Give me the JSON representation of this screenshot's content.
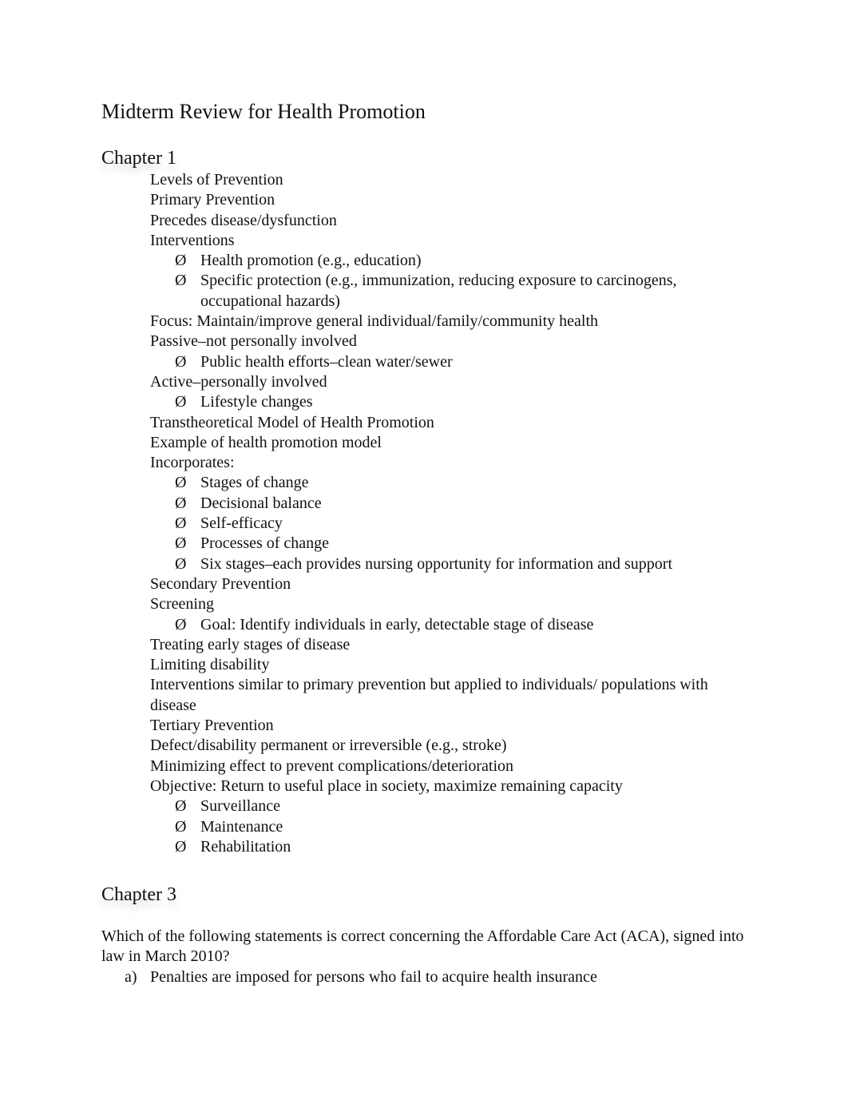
{
  "document": {
    "title": "Midterm Review for Health Promotion",
    "chapter1": {
      "heading": "Chapter 1",
      "lines": [
        {
          "type": "text",
          "text": "Levels of Prevention"
        },
        {
          "type": "text",
          "text": "Primary Prevention"
        },
        {
          "type": "text",
          "text": "Precedes disease/dysfunction"
        },
        {
          "type": "text",
          "text": "Interventions"
        },
        {
          "type": "bullet",
          "text": "Health promotion (e.g., education)"
        },
        {
          "type": "bullet",
          "text": "Specific protection (e.g., immunization, reducing exposure to carcinogens, occupational hazards)"
        },
        {
          "type": "text",
          "text": "Focus: Maintain/improve general individual/family/community health"
        },
        {
          "type": "text",
          "text": "Passive–not personally involved"
        },
        {
          "type": "bullet",
          "text": "Public health efforts–clean water/sewer"
        },
        {
          "type": "text",
          "text": "Active–personally involved"
        },
        {
          "type": "bullet",
          "text": "Lifestyle changes"
        },
        {
          "type": "text",
          "text": "Transtheoretical Model of Health Promotion"
        },
        {
          "type": "text",
          "text": "Example of health promotion model"
        },
        {
          "type": "text",
          "text": "Incorporates:"
        },
        {
          "type": "bullet",
          "text": "Stages of change"
        },
        {
          "type": "bullet",
          "text": "Decisional balance"
        },
        {
          "type": "bullet",
          "text": "Self-efficacy"
        },
        {
          "type": "bullet",
          "text": "Processes of change"
        },
        {
          "type": "bullet",
          "text": "Six stages–each provides nursing opportunity for information and support"
        },
        {
          "type": "text",
          "text": "Secondary Prevention"
        },
        {
          "type": "text",
          "text": "Screening"
        },
        {
          "type": "bullet",
          "text": "Goal: Identify individuals in early, detectable stage of disease"
        },
        {
          "type": "text",
          "text": "Treating early stages of disease"
        },
        {
          "type": "text",
          "text": "Limiting disability"
        },
        {
          "type": "text",
          "text": "Interventions similar to primary prevention but applied to individuals/ populations with disease"
        },
        {
          "type": "text",
          "text": "Tertiary Prevention"
        },
        {
          "type": "text",
          "text": "Defect/disability permanent or irreversible (e.g., stroke)"
        },
        {
          "type": "text",
          "text": "Minimizing effect to prevent complications/deterioration"
        },
        {
          "type": "text",
          "text": "Objective: Return to useful place in society, maximize remaining capacity"
        },
        {
          "type": "bullet",
          "text": "Surveillance"
        },
        {
          "type": "bullet",
          "text": "Maintenance"
        },
        {
          "type": "bullet",
          "text": "Rehabilitation"
        }
      ]
    },
    "bullet_marker": "Ø",
    "chapter3": {
      "heading": "Chapter 3",
      "question": "Which of the following statements is correct concerning the Affordable Care Act (ACA), signed into law in March 2010?",
      "answers": [
        {
          "letter": "a)",
          "text": "Penalties are imposed for persons who fail to acquire health insurance"
        }
      ]
    }
  }
}
